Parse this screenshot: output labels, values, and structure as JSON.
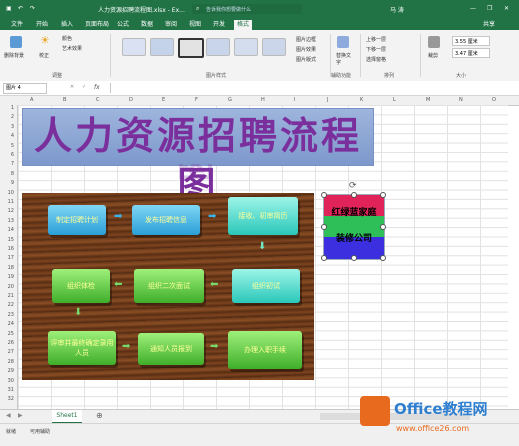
{
  "window": {
    "title": "人力资源招聘流程图.xlsx - Ex...",
    "search_placeholder": "告诉我你想要做什么",
    "user": "马 涛"
  },
  "tabs": [
    "文件",
    "开始",
    "插入",
    "页面布局",
    "公式",
    "数据",
    "审阅",
    "视图",
    "开发",
    "格式"
  ],
  "active_tab": "格式",
  "share_label": "共享",
  "ribbon": {
    "remove_bg": "删除背景",
    "correct": "校正",
    "color": "颜色",
    "art_effects": "艺术效果",
    "adjust_group": "调整",
    "styles_group": "图片样式",
    "border": "图片边框",
    "effects": "图片效果",
    "layout": "图片版式",
    "alt_text": "替换文字",
    "access_group": "辅助功能",
    "bring_forward": "上移一层",
    "send_backward": "下移一层",
    "selection_pane": "选择窗格",
    "arrange_group": "排列",
    "crop": "裁剪",
    "height": "3.55 厘米",
    "width": "3.47 厘米",
    "size_group": "大小"
  },
  "formula_bar": {
    "name_box": "图片 4",
    "fx": "fx"
  },
  "columns": [
    "A",
    "B",
    "C",
    "D",
    "E",
    "F",
    "G",
    "H",
    "I",
    "J",
    "K",
    "L",
    "M",
    "N",
    "O"
  ],
  "rows": [
    "1",
    "2",
    "3",
    "4",
    "5",
    "6",
    "7",
    "8",
    "9",
    "10",
    "11",
    "12",
    "13",
    "14",
    "15",
    "16",
    "17",
    "18",
    "19",
    "20",
    "21",
    "22",
    "23",
    "24",
    "25",
    "26",
    "27",
    "28",
    "29",
    "30",
    "31",
    "32"
  ],
  "wordart_title": "人力资源招聘流程图",
  "flow_steps": [
    "制定招聘计划",
    "发布招聘信息",
    "接收、初审简历",
    "组织初试",
    "组织二次面试",
    "组织体检",
    "评审并最终确定录用人员",
    "通知人员报到",
    "办理入职手续"
  ],
  "logo": {
    "line1": "红绿蓝家庭",
    "line2": "装修公司"
  },
  "sheet_tab": "Sheet1",
  "status": {
    "ready": "就绪",
    "accessibility": "可用辅助"
  },
  "watermark": {
    "brand": "Office教程网",
    "url": "www.office26.com"
  }
}
